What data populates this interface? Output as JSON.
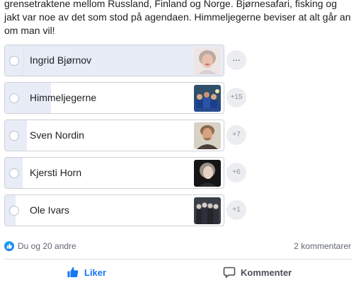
{
  "post": {
    "text": "grensetraktene mellom Russland, Finland og Norge. Bjørnesafari, fisking og jakt var noe av det som stod på agendaen. Himmeljegerne beviser at alt går an om man vil!"
  },
  "poll": {
    "options": [
      {
        "label": "Ingrid Bjørnov",
        "bubble": "...",
        "vote_share": 1.0,
        "thumb_icon": "woman-portrait"
      },
      {
        "label": "Himmeljegerne",
        "bubble": "+15",
        "vote_share": 0.21,
        "thumb_icon": "group-photo"
      },
      {
        "label": "Sven Nordin",
        "bubble": "+7",
        "vote_share": 0.1,
        "thumb_icon": "man-portrait"
      },
      {
        "label": "Kjersti Horn",
        "bubble": "+6",
        "vote_share": 0.08,
        "thumb_icon": "woman-portrait"
      },
      {
        "label": "Ole Ivars",
        "bubble": "+1",
        "vote_share": 0.05,
        "thumb_icon": "band-photo"
      }
    ]
  },
  "reactions": {
    "text": "Du og 20 andre",
    "icon": "thumb-up-icon",
    "color": "#1877f2"
  },
  "comments": {
    "count_text": "2 kommentarer"
  },
  "actions": {
    "like": {
      "label": "Liker",
      "icon": "thumb-up-icon",
      "active_color": "#1877f2"
    },
    "comment": {
      "label": "Kommenter",
      "icon": "comment-icon"
    }
  },
  "colors": {
    "poll_fill": "#e7ecf6",
    "border": "#ced0d4",
    "muted_text": "#606770"
  }
}
